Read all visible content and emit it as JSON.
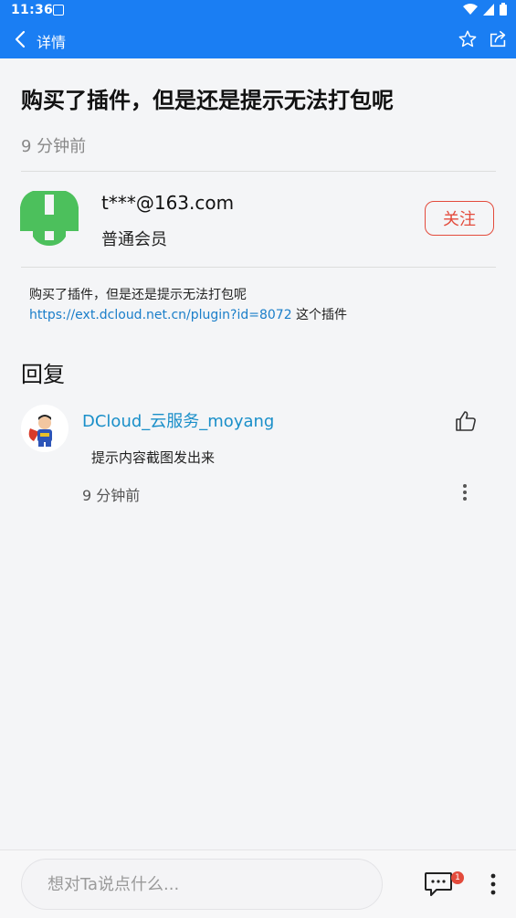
{
  "status_bar": {
    "time": "11:36",
    "icons": [
      "notification-a-icon",
      "wifi-icon",
      "signal-icon",
      "battery-icon"
    ]
  },
  "nav": {
    "back_icon": "chevron-left-icon",
    "title": "详情",
    "favorite_icon": "star-icon",
    "share_icon": "share-icon"
  },
  "post": {
    "title": "购买了插件，但是还是提示无法打包呢",
    "time": "9 分钟前",
    "author": {
      "name": "t***@163.com",
      "level": "普通会员",
      "follow_label": "关注"
    },
    "content_text": "购买了插件，但是还是提示无法打包呢",
    "content_link": "https://ext.dcloud.net.cn/plugin?id=8072",
    "content_suffix": " 这个插件"
  },
  "replies": {
    "heading": "回复",
    "items": [
      {
        "user": "DCloud_云服务_moyang",
        "text": "提示内容截图发出来",
        "time": "9 分钟前"
      }
    ]
  },
  "bottom_bar": {
    "placeholder": "想对Ta说点什么...",
    "comment_count": "1"
  },
  "colors": {
    "primary": "#1a7ef3",
    "follow_red": "#e34b3c",
    "link_blue": "#1a7ec9",
    "avatar_green": "#4cc05c"
  }
}
